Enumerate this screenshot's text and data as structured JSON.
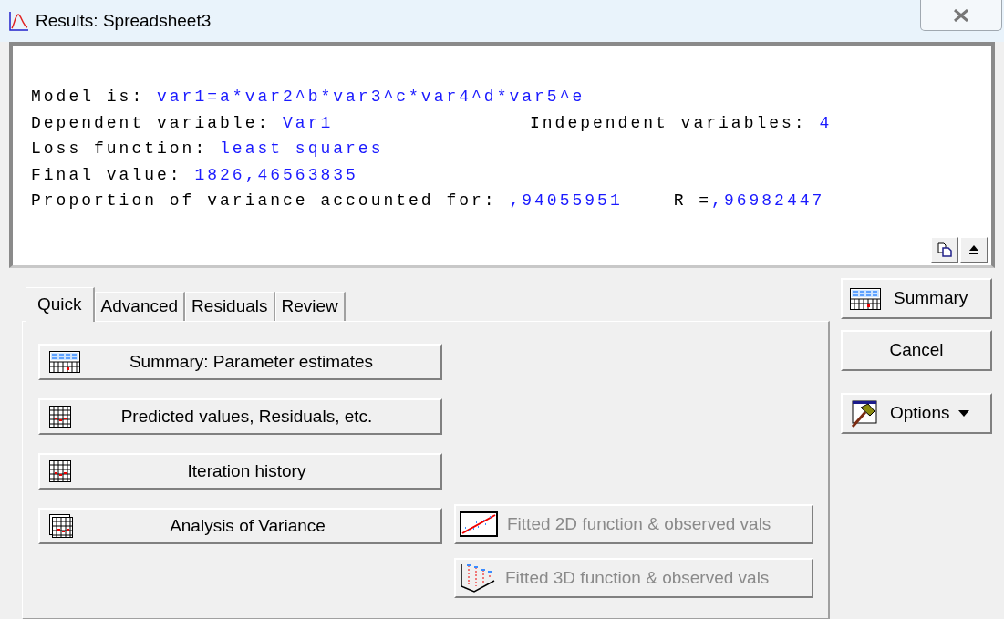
{
  "window": {
    "title": "Results: Spreadsheet3"
  },
  "output": {
    "lines": [
      {
        "parts": [
          {
            "kind": "plain",
            "label": "Model is:",
            "value": "var1=a*var2^b*var3^c*var4^d*var5^e"
          }
        ]
      },
      {
        "parts": [
          {
            "kind": "column",
            "label": "Dependent variable:",
            "value": "Var1"
          },
          {
            "kind": "plain",
            "label": "Independent variables:",
            "value": "4"
          }
        ]
      },
      {
        "parts": [
          {
            "kind": "plain",
            "label": "Loss function:",
            "value": "least squares"
          }
        ]
      },
      {
        "parts": [
          {
            "kind": "plain",
            "label": "Final value:",
            "value": "1826,46563835"
          }
        ]
      },
      {
        "parts": [
          {
            "kind": "plain",
            "label": "Proportion of variance accounted for:",
            "value": ",94055951"
          },
          {
            "kind": "spaced",
            "label": "R =",
            "value": ",96982447"
          }
        ]
      }
    ]
  },
  "tabs": [
    {
      "label": "Quick",
      "selected": true
    },
    {
      "label": "Advanced",
      "selected": false
    },
    {
      "label": "Residuals",
      "selected": false
    },
    {
      "label": "Review",
      "selected": false
    }
  ],
  "quick_buttons": [
    {
      "label": "Summary: Parameter estimates",
      "kind": "summary",
      "disabled": false
    },
    {
      "label": "Predicted values, Residuals, etc.",
      "kind": "table",
      "disabled": false
    },
    {
      "label": "Iteration history",
      "kind": "table",
      "disabled": false
    },
    {
      "label": "Analysis of Variance",
      "kind": "tables",
      "disabled": false
    }
  ],
  "graph_buttons": [
    {
      "label": "Fitted 2D function & observed vals",
      "kind": "plot2d",
      "disabled": true
    },
    {
      "label": "Fitted 3D function & observed vals",
      "kind": "plot3d",
      "disabled": true
    }
  ],
  "side_buttons": [
    {
      "label": "Summary",
      "kind": "summary"
    },
    {
      "label": "Cancel",
      "kind": "plain"
    },
    {
      "label": "Options",
      "kind": "hammer",
      "dropdown": true
    }
  ]
}
